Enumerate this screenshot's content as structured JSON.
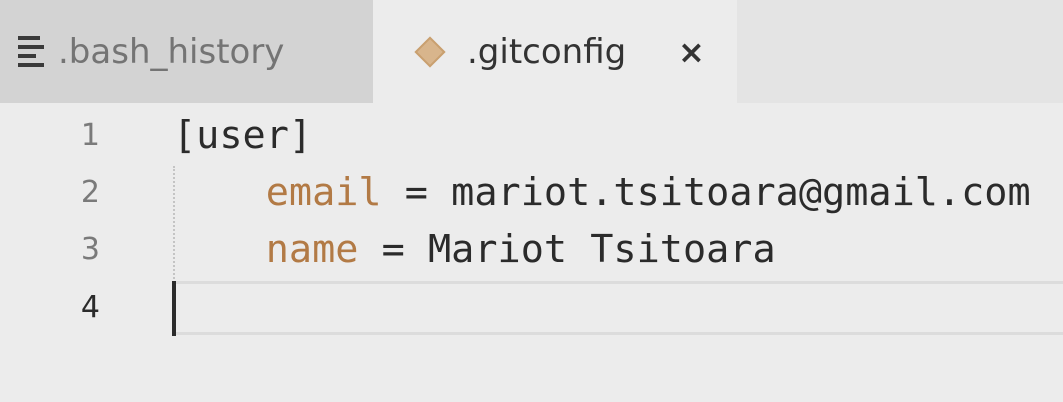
{
  "tabs": [
    {
      "label": ".bash_history",
      "icon": "lines-icon",
      "active": false
    },
    {
      "label": ".gitconfig",
      "icon": "git-icon",
      "active": true,
      "close": "×"
    }
  ],
  "editor": {
    "lines": [
      {
        "num": "1",
        "text": "[user]"
      },
      {
        "num": "2",
        "key": "email",
        "sep": " = ",
        "value": "mariot.tsitoara@gmail.com"
      },
      {
        "num": "3",
        "key": "name",
        "sep": " = ",
        "value": "Mariot Tsitoara"
      },
      {
        "num": "4",
        "text": ""
      }
    ],
    "indent": "    "
  },
  "colors": {
    "key": "#b27a45",
    "text": "#2b2b2b"
  }
}
